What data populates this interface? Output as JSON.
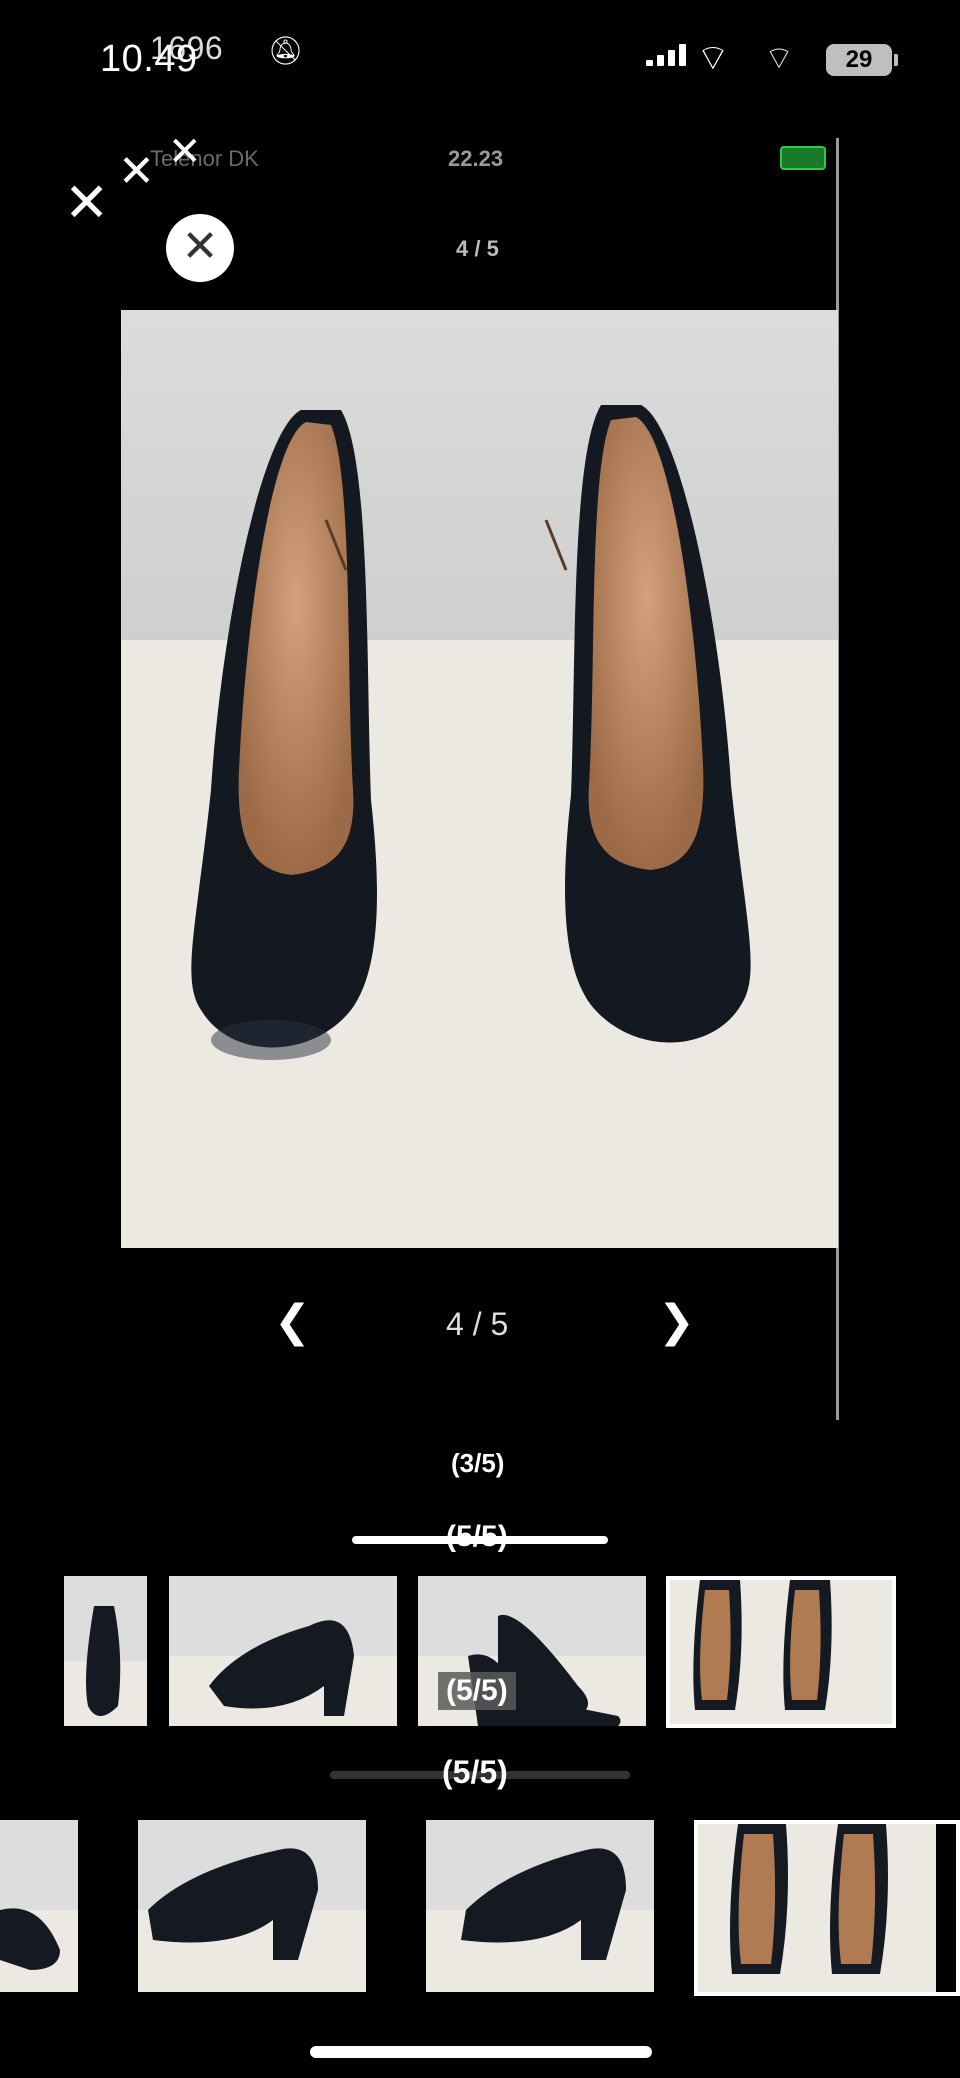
{
  "status_bar": {
    "time": "10.49",
    "time_ghost": "1696",
    "battery": "29",
    "icons": [
      "bell-mute-icon",
      "signal-icon",
      "wifi-icon",
      "battery-icon"
    ]
  },
  "inner_status": {
    "carrier": "Telenor DK",
    "time": "22.23"
  },
  "viewer": {
    "top_counter": "4 / 5",
    "counter": "4 / 5",
    "prev_icon": "chevron-left-icon",
    "next_icon": "chevron-right-icon",
    "close_icon": "close-icon"
  },
  "overlay_labels": {
    "a": "(3/5)",
    "b": "(5/5)",
    "c": "(5/5)",
    "d": "(5/5)"
  },
  "thumbnails_row1_selected": 4,
  "thumbnails_row2_selected": 4
}
